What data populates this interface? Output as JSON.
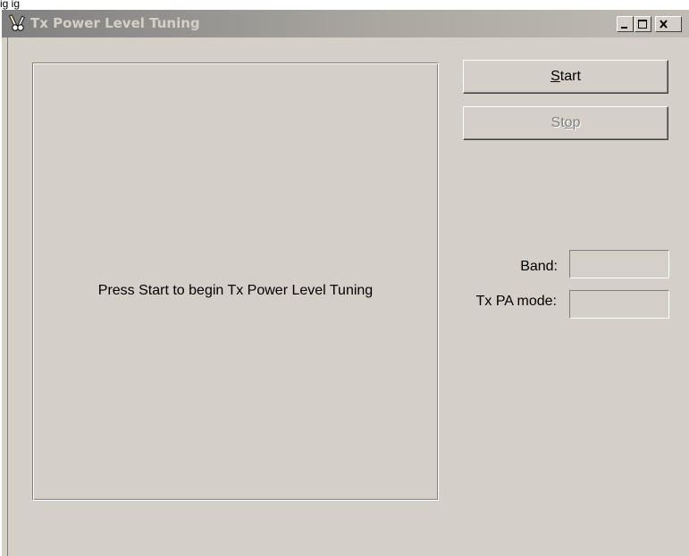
{
  "background_text": "ig  ig",
  "window": {
    "title": "Tx Power Level Tuning",
    "icon": "wrench-screwdriver-icon",
    "controls": [
      "minimize-icon",
      "maximize-icon",
      "close-icon"
    ]
  },
  "panel": {
    "message": "Press Start to begin Tx Power Level Tuning"
  },
  "buttons": {
    "start": {
      "mnemonic": "S",
      "rest": "tart",
      "enabled": true
    },
    "stop": {
      "before": "St",
      "mnemonic": "o",
      "after": "p",
      "enabled": false
    }
  },
  "fields": {
    "band_label": "Band:",
    "band_value": "",
    "pa_mode_label": "Tx PA mode:",
    "pa_mode_value": ""
  },
  "colors": {
    "face": "#d4d0c8",
    "title_gradient_start": "#808080",
    "title_text": "#d4d0c8",
    "disabled_text": "#808080"
  }
}
